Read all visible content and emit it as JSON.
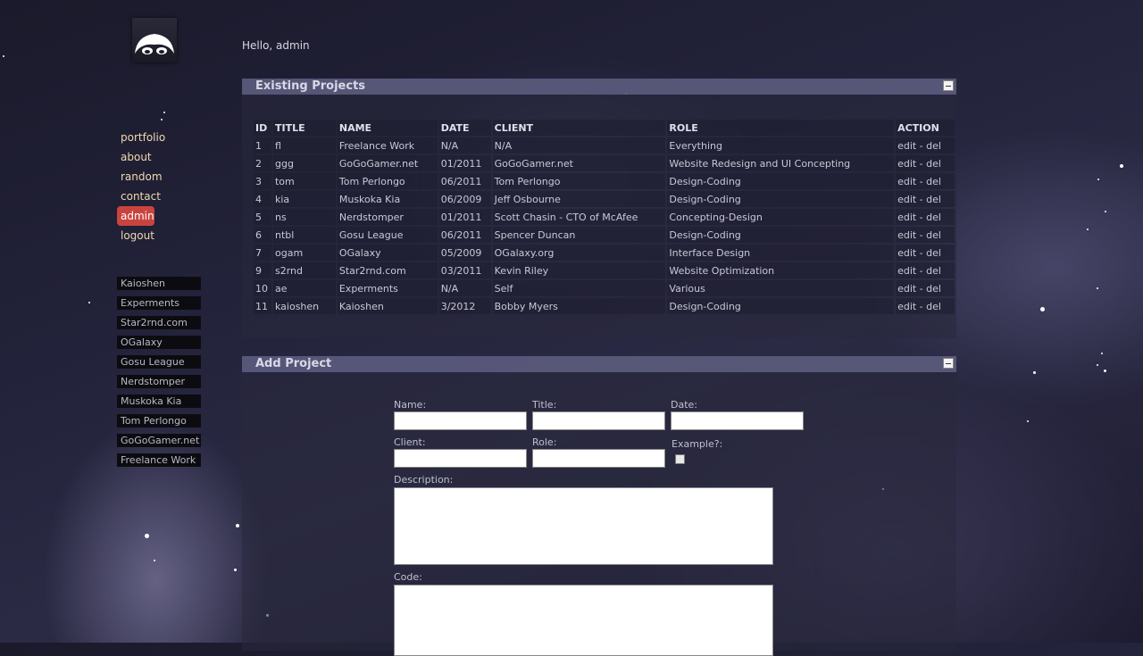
{
  "greeting": "Hello, admin",
  "nav": {
    "items": [
      {
        "label": "portfolio"
      },
      {
        "label": "about"
      },
      {
        "label": "random"
      },
      {
        "label": "contact"
      },
      {
        "label": "admin",
        "active": true
      },
      {
        "label": "logout"
      }
    ]
  },
  "projects_nav": [
    "Kaioshen",
    "Experments",
    "Star2rnd.com",
    "OGalaxy",
    "Gosu League",
    "Nerdstomper",
    "Muskoka Kia",
    "Tom Perlongo",
    "GoGoGamer.net",
    "Freelance Work"
  ],
  "existing_panel": {
    "title": "Existing Projects",
    "columns": [
      "ID",
      "TITLE",
      "NAME",
      "DATE",
      "CLIENT",
      "ROLE",
      "ACTION"
    ],
    "rows": [
      {
        "id": "1",
        "title": "fl",
        "name": "Freelance Work",
        "date": "N/A",
        "client": "N/A",
        "role": "Everything",
        "action": "edit - del"
      },
      {
        "id": "2",
        "title": "ggg",
        "name": "GoGoGamer.net",
        "date": "01/2011",
        "client": "GoGoGamer.net",
        "role": "Website Redesign and UI Concepting",
        "action": "edit - del"
      },
      {
        "id": "3",
        "title": "tom",
        "name": "Tom Perlongo",
        "date": "06/2011",
        "client": "Tom Perlongo",
        "role": "Design-Coding",
        "action": "edit - del"
      },
      {
        "id": "4",
        "title": "kia",
        "name": "Muskoka Kia",
        "date": "06/2009",
        "client": "Jeff Osbourne",
        "role": "Design-Coding",
        "action": "edit - del"
      },
      {
        "id": "5",
        "title": "ns",
        "name": "Nerdstomper",
        "date": "01/2011",
        "client": "Scott Chasin - CTO of McAfee",
        "role": "Concepting-Design",
        "action": "edit - del"
      },
      {
        "id": "6",
        "title": "ntbl",
        "name": "Gosu League",
        "date": "06/2011",
        "client": "Spencer Duncan",
        "role": "Design-Coding",
        "action": "edit - del"
      },
      {
        "id": "7",
        "title": "ogam",
        "name": "OGalaxy",
        "date": "05/2009",
        "client": "OGalaxy.org",
        "role": "Interface Design",
        "action": "edit - del"
      },
      {
        "id": "9",
        "title": "s2rnd",
        "name": "Star2rnd.com",
        "date": "03/2011",
        "client": "Kevin Riley",
        "role": "Website Optimization",
        "action": "edit - del"
      },
      {
        "id": "10",
        "title": "ae",
        "name": "Experments",
        "date": "N/A",
        "client": "Self",
        "role": "Various",
        "action": "edit - del"
      },
      {
        "id": "11",
        "title": "kaioshen",
        "name": "Kaioshen",
        "date": "3/2012",
        "client": "Bobby Myers",
        "role": "Design-Coding",
        "action": "edit - del"
      }
    ]
  },
  "add_panel": {
    "title": "Add Project",
    "labels": {
      "name": "Name:",
      "title": "Title:",
      "date": "Date:",
      "client": "Client:",
      "role": "Role:",
      "example": "Example?:",
      "description": "Description:",
      "code": "Code:"
    },
    "values": {
      "name": "",
      "title": "",
      "date": "",
      "client": "",
      "role": "",
      "example_checked": false,
      "description": "",
      "code": ""
    }
  },
  "icons": {
    "logo": "logo-icon",
    "collapse": "collapse-icon"
  }
}
